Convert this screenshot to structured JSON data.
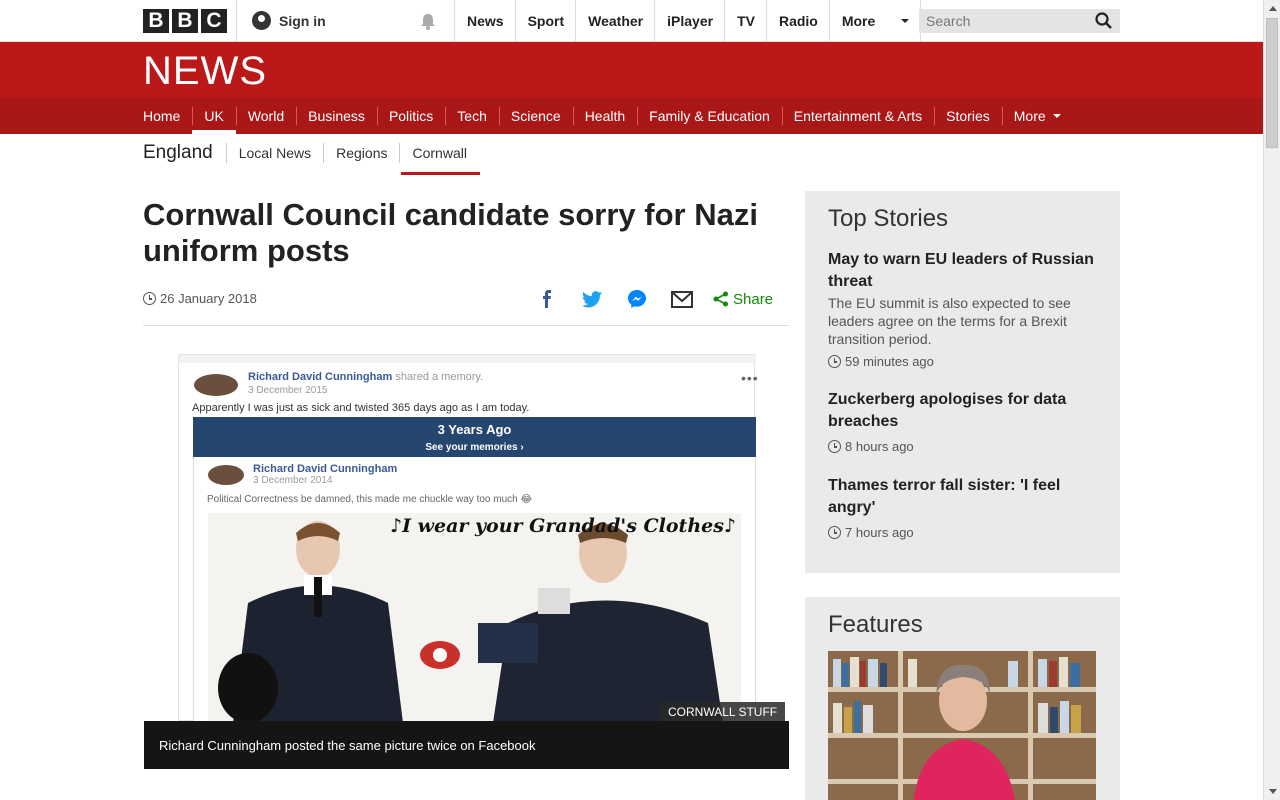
{
  "bbc_bar": {
    "logo_letters": [
      "B",
      "B",
      "C"
    ],
    "signin_label": "Sign in",
    "nav": [
      "News",
      "Sport",
      "Weather",
      "iPlayer",
      "TV",
      "Radio",
      "More"
    ],
    "search_placeholder": "Search"
  },
  "news_header": {
    "logo": "NEWS",
    "sections": [
      "Home",
      "UK",
      "World",
      "Business",
      "Politics",
      "Tech",
      "Science",
      "Health",
      "Family & Education",
      "Entertainment & Arts",
      "Stories",
      "More"
    ],
    "active_section": "UK"
  },
  "subnav": {
    "region": "England",
    "items": [
      "Local News",
      "Regions",
      "Cornwall"
    ],
    "active_item": "Cornwall"
  },
  "article": {
    "headline": "Cornwall Council candidate sorry for Nazi uniform posts",
    "date": "26 January 2018",
    "share_label": "Share",
    "figure": {
      "fb_name": "Richard David Cunningham",
      "fb_action": "shared a memory.",
      "fb_date": "3 December 2015",
      "fb_status": "Apparently I was just as sick and twisted 365 days ago as I am today.",
      "banner_title": "3 Years Ago",
      "banner_sub": "See your memories ›",
      "inner_name": "Richard David Cunningham",
      "inner_date": "3 December 2014",
      "inner_status": "Political Correctness be damned, this made me chuckle way too much 😂",
      "image_text": "♪I wear your Grandad's Clothes♪",
      "credit": "CORNWALL STUFF",
      "caption": "Richard Cunningham posted the same picture twice on Facebook"
    }
  },
  "top_stories": {
    "heading": "Top Stories",
    "items": [
      {
        "title": "May to warn EU leaders of Russian threat",
        "summary": "The EU summit is also expected to see leaders agree on the terms for a Brexit transition period.",
        "time": "59 minutes ago"
      },
      {
        "title": "Zuckerberg apologises for data breaches",
        "summary": "",
        "time": "8 hours ago"
      },
      {
        "title": "Thames terror fall sister: 'I feel angry'",
        "summary": "",
        "time": "7 hours ago"
      }
    ]
  },
  "features": {
    "heading": "Features"
  },
  "colors": {
    "brand_red": "#bb1919",
    "nav_red": "#a91717",
    "share_green": "#148a0a"
  }
}
